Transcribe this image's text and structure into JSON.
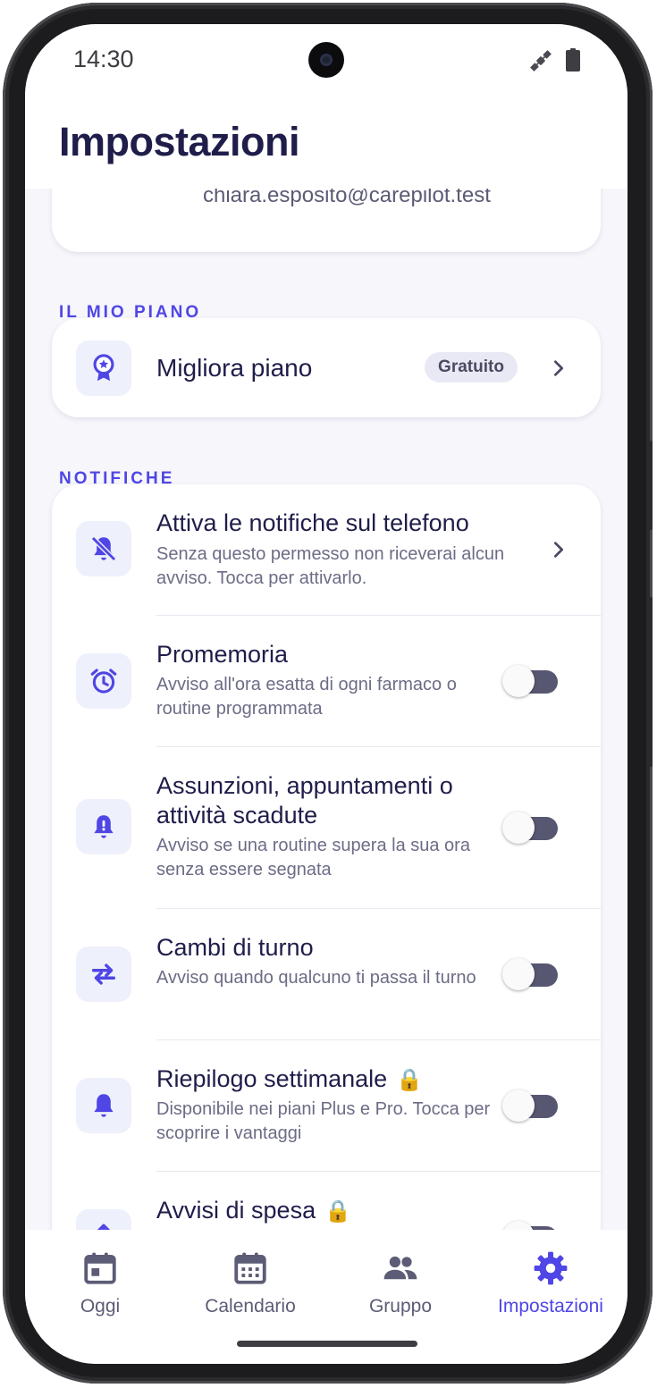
{
  "status_bar": {
    "time": "14:30",
    "icons": [
      "satellite-icon",
      "battery-icon"
    ]
  },
  "header": {
    "title": "Impostazioni"
  },
  "profile": {
    "email": "chiara.esposito@carepilot.test"
  },
  "plan_section": {
    "label": "IL MIO PIANO",
    "item": {
      "icon": "award-icon",
      "title": "Migliora piano",
      "badge": "Gratuito"
    }
  },
  "notifications_section": {
    "label": "NOTIFICHE",
    "items": [
      {
        "icon": "bell-off-icon",
        "title": "Attiva le notifiche sul telefono",
        "subtitle": "Senza questo permesso non riceverai alcun avviso. Tocca per attivarlo.",
        "control": "chevron"
      },
      {
        "icon": "alarm-clock-icon",
        "title": "Promemoria",
        "subtitle": "Avviso all'ora esatta di ogni farmaco o routine programmata",
        "control": "toggle",
        "enabled": false
      },
      {
        "icon": "bell-alert-icon",
        "title": "Assunzioni, appuntamenti o attività scadute",
        "subtitle": "Avviso se una routine supera la sua ora senza essere segnata",
        "control": "toggle",
        "enabled": false
      },
      {
        "icon": "swap-arrows-icon",
        "title": "Cambi di turno",
        "subtitle": "Avviso quando qualcuno ti passa il turno",
        "control": "toggle",
        "enabled": false
      },
      {
        "icon": "bell-icon",
        "title": "Riepilogo settimanale",
        "lock": "🔒",
        "subtitle": "Disponibile nei piani Plus e Pro. Tocca per scoprire i vantaggi",
        "control": "toggle",
        "enabled": false
      },
      {
        "icon": "expense-icon",
        "title": "Avvisi di spesa",
        "lock": "🔒",
        "subtitle": "",
        "control": "toggle",
        "enabled": false
      }
    ]
  },
  "bottom_nav": {
    "items": [
      {
        "icon": "calendar-today-icon",
        "label": "Oggi",
        "active": false
      },
      {
        "icon": "calendar-month-icon",
        "label": "Calendario",
        "active": false
      },
      {
        "icon": "group-icon",
        "label": "Gruppo",
        "active": false
      },
      {
        "icon": "gear-icon",
        "label": "Impostazioni",
        "active": true
      }
    ]
  },
  "colors": {
    "accent": "#4f46e5",
    "text_primary": "#1f1d4a",
    "text_secondary": "#6c6c86",
    "background": "#f6f6fb",
    "icon_tile": "#eef0fb",
    "toggle_track_off": "#575772"
  }
}
